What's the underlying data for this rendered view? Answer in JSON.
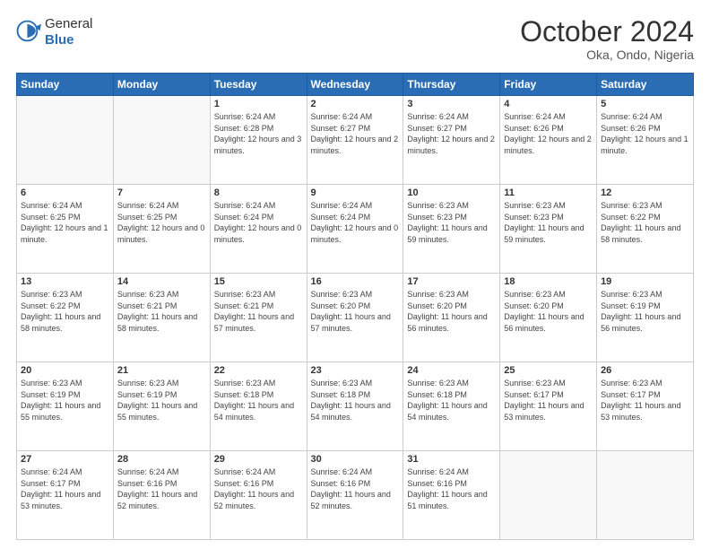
{
  "logo": {
    "general": "General",
    "blue": "Blue"
  },
  "title": "October 2024",
  "location": "Oka, Ondo, Nigeria",
  "days_of_week": [
    "Sunday",
    "Monday",
    "Tuesday",
    "Wednesday",
    "Thursday",
    "Friday",
    "Saturday"
  ],
  "weeks": [
    [
      {
        "day": "",
        "empty": true
      },
      {
        "day": "",
        "empty": true
      },
      {
        "day": "1",
        "sunrise": "6:24 AM",
        "sunset": "6:28 PM",
        "daylight": "12 hours and 3 minutes."
      },
      {
        "day": "2",
        "sunrise": "6:24 AM",
        "sunset": "6:27 PM",
        "daylight": "12 hours and 2 minutes."
      },
      {
        "day": "3",
        "sunrise": "6:24 AM",
        "sunset": "6:27 PM",
        "daylight": "12 hours and 2 minutes."
      },
      {
        "day": "4",
        "sunrise": "6:24 AM",
        "sunset": "6:26 PM",
        "daylight": "12 hours and 2 minutes."
      },
      {
        "day": "5",
        "sunrise": "6:24 AM",
        "sunset": "6:26 PM",
        "daylight": "12 hours and 1 minute."
      }
    ],
    [
      {
        "day": "6",
        "sunrise": "6:24 AM",
        "sunset": "6:25 PM",
        "daylight": "12 hours and 1 minute."
      },
      {
        "day": "7",
        "sunrise": "6:24 AM",
        "sunset": "6:25 PM",
        "daylight": "12 hours and 0 minutes."
      },
      {
        "day": "8",
        "sunrise": "6:24 AM",
        "sunset": "6:24 PM",
        "daylight": "12 hours and 0 minutes."
      },
      {
        "day": "9",
        "sunrise": "6:24 AM",
        "sunset": "6:24 PM",
        "daylight": "12 hours and 0 minutes."
      },
      {
        "day": "10",
        "sunrise": "6:23 AM",
        "sunset": "6:23 PM",
        "daylight": "11 hours and 59 minutes."
      },
      {
        "day": "11",
        "sunrise": "6:23 AM",
        "sunset": "6:23 PM",
        "daylight": "11 hours and 59 minutes."
      },
      {
        "day": "12",
        "sunrise": "6:23 AM",
        "sunset": "6:22 PM",
        "daylight": "11 hours and 58 minutes."
      }
    ],
    [
      {
        "day": "13",
        "sunrise": "6:23 AM",
        "sunset": "6:22 PM",
        "daylight": "11 hours and 58 minutes."
      },
      {
        "day": "14",
        "sunrise": "6:23 AM",
        "sunset": "6:21 PM",
        "daylight": "11 hours and 58 minutes."
      },
      {
        "day": "15",
        "sunrise": "6:23 AM",
        "sunset": "6:21 PM",
        "daylight": "11 hours and 57 minutes."
      },
      {
        "day": "16",
        "sunrise": "6:23 AM",
        "sunset": "6:20 PM",
        "daylight": "11 hours and 57 minutes."
      },
      {
        "day": "17",
        "sunrise": "6:23 AM",
        "sunset": "6:20 PM",
        "daylight": "11 hours and 56 minutes."
      },
      {
        "day": "18",
        "sunrise": "6:23 AM",
        "sunset": "6:20 PM",
        "daylight": "11 hours and 56 minutes."
      },
      {
        "day": "19",
        "sunrise": "6:23 AM",
        "sunset": "6:19 PM",
        "daylight": "11 hours and 56 minutes."
      }
    ],
    [
      {
        "day": "20",
        "sunrise": "6:23 AM",
        "sunset": "6:19 PM",
        "daylight": "11 hours and 55 minutes."
      },
      {
        "day": "21",
        "sunrise": "6:23 AM",
        "sunset": "6:19 PM",
        "daylight": "11 hours and 55 minutes."
      },
      {
        "day": "22",
        "sunrise": "6:23 AM",
        "sunset": "6:18 PM",
        "daylight": "11 hours and 54 minutes."
      },
      {
        "day": "23",
        "sunrise": "6:23 AM",
        "sunset": "6:18 PM",
        "daylight": "11 hours and 54 minutes."
      },
      {
        "day": "24",
        "sunrise": "6:23 AM",
        "sunset": "6:18 PM",
        "daylight": "11 hours and 54 minutes."
      },
      {
        "day": "25",
        "sunrise": "6:23 AM",
        "sunset": "6:17 PM",
        "daylight": "11 hours and 53 minutes."
      },
      {
        "day": "26",
        "sunrise": "6:23 AM",
        "sunset": "6:17 PM",
        "daylight": "11 hours and 53 minutes."
      }
    ],
    [
      {
        "day": "27",
        "sunrise": "6:24 AM",
        "sunset": "6:17 PM",
        "daylight": "11 hours and 53 minutes."
      },
      {
        "day": "28",
        "sunrise": "6:24 AM",
        "sunset": "6:16 PM",
        "daylight": "11 hours and 52 minutes."
      },
      {
        "day": "29",
        "sunrise": "6:24 AM",
        "sunset": "6:16 PM",
        "daylight": "11 hours and 52 minutes."
      },
      {
        "day": "30",
        "sunrise": "6:24 AM",
        "sunset": "6:16 PM",
        "daylight": "11 hours and 52 minutes."
      },
      {
        "day": "31",
        "sunrise": "6:24 AM",
        "sunset": "6:16 PM",
        "daylight": "11 hours and 51 minutes."
      },
      {
        "day": "",
        "empty": true
      },
      {
        "day": "",
        "empty": true
      }
    ]
  ],
  "labels": {
    "sunrise": "Sunrise:",
    "sunset": "Sunset:",
    "daylight": "Daylight:"
  }
}
